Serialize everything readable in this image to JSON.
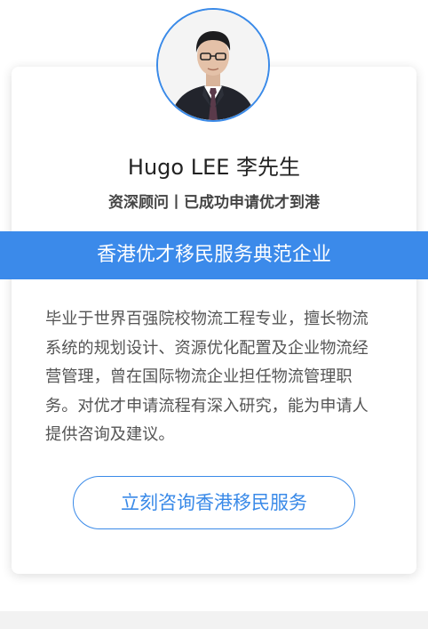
{
  "profile": {
    "name": "Hugo LEE 李先生",
    "subtitle": "资深顾问丨已成功申请优才到港",
    "banner": "香港优才移民服务典范企业",
    "bio": "毕业于世界百强院校物流工程专业，擅长物流系统的规划设计、资源优化配置及企业物流经营管理，曾在国际物流企业担任物流管理职务。对优才申请流程有深入研究，能为申请人提供咨询及建议。",
    "avatar_icon": "person-portrait-icon"
  },
  "cta": {
    "label": "立刻咨询香港移民服务"
  },
  "colors": {
    "accent": "#3b8aea",
    "text_dark": "#222222",
    "text_body": "#555555"
  }
}
